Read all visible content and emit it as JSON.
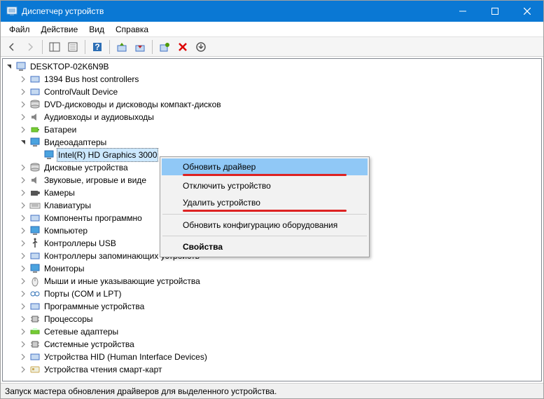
{
  "window": {
    "title": "Диспетчер устройств"
  },
  "menu": {
    "file": "Файл",
    "action": "Действие",
    "view": "Вид",
    "help": "Справка"
  },
  "tree": {
    "root": "DESKTOP-02K6N9B",
    "nodes": {
      "n1394": "1394 Bus host controllers",
      "controlvault": "ControlVault Device",
      "dvd": "DVD-дисководы и дисководы компакт-дисков",
      "audio": "Аудиовходы и аудиовыходы",
      "battery": "Батареи",
      "video": "Видеоадаптеры",
      "intel_gpu": "Intel(R) HD Graphics 3000",
      "disk": "Дисковые устройства",
      "sound": "Звуковые, игровые и виде",
      "cameras": "Камеры",
      "keyboards": "Клавиатуры",
      "software_components": "Компоненты программно",
      "computer": "Компьютер",
      "usb": "Контроллеры USB",
      "storage": "Контроллеры запоминающих устройств",
      "monitors": "Мониторы",
      "mice": "Мыши и иные указывающие устройства",
      "ports": "Порты (COM и LPT)",
      "software_devices": "Программные устройства",
      "cpus": "Процессоры",
      "network": "Сетевые адаптеры",
      "system": "Системные устройства",
      "hid": "Устройства HID (Human Interface Devices)",
      "smartcard": "Устройства чтения смарт-карт"
    }
  },
  "context": {
    "update_driver": "Обновить драйвер",
    "disable_device": "Отключить устройство",
    "remove_device": "Удалить устройство",
    "refresh_hw": "Обновить конфигурацию оборудования",
    "properties": "Свойства"
  },
  "status": "Запуск мастера обновления драйверов для выделенного устройства."
}
